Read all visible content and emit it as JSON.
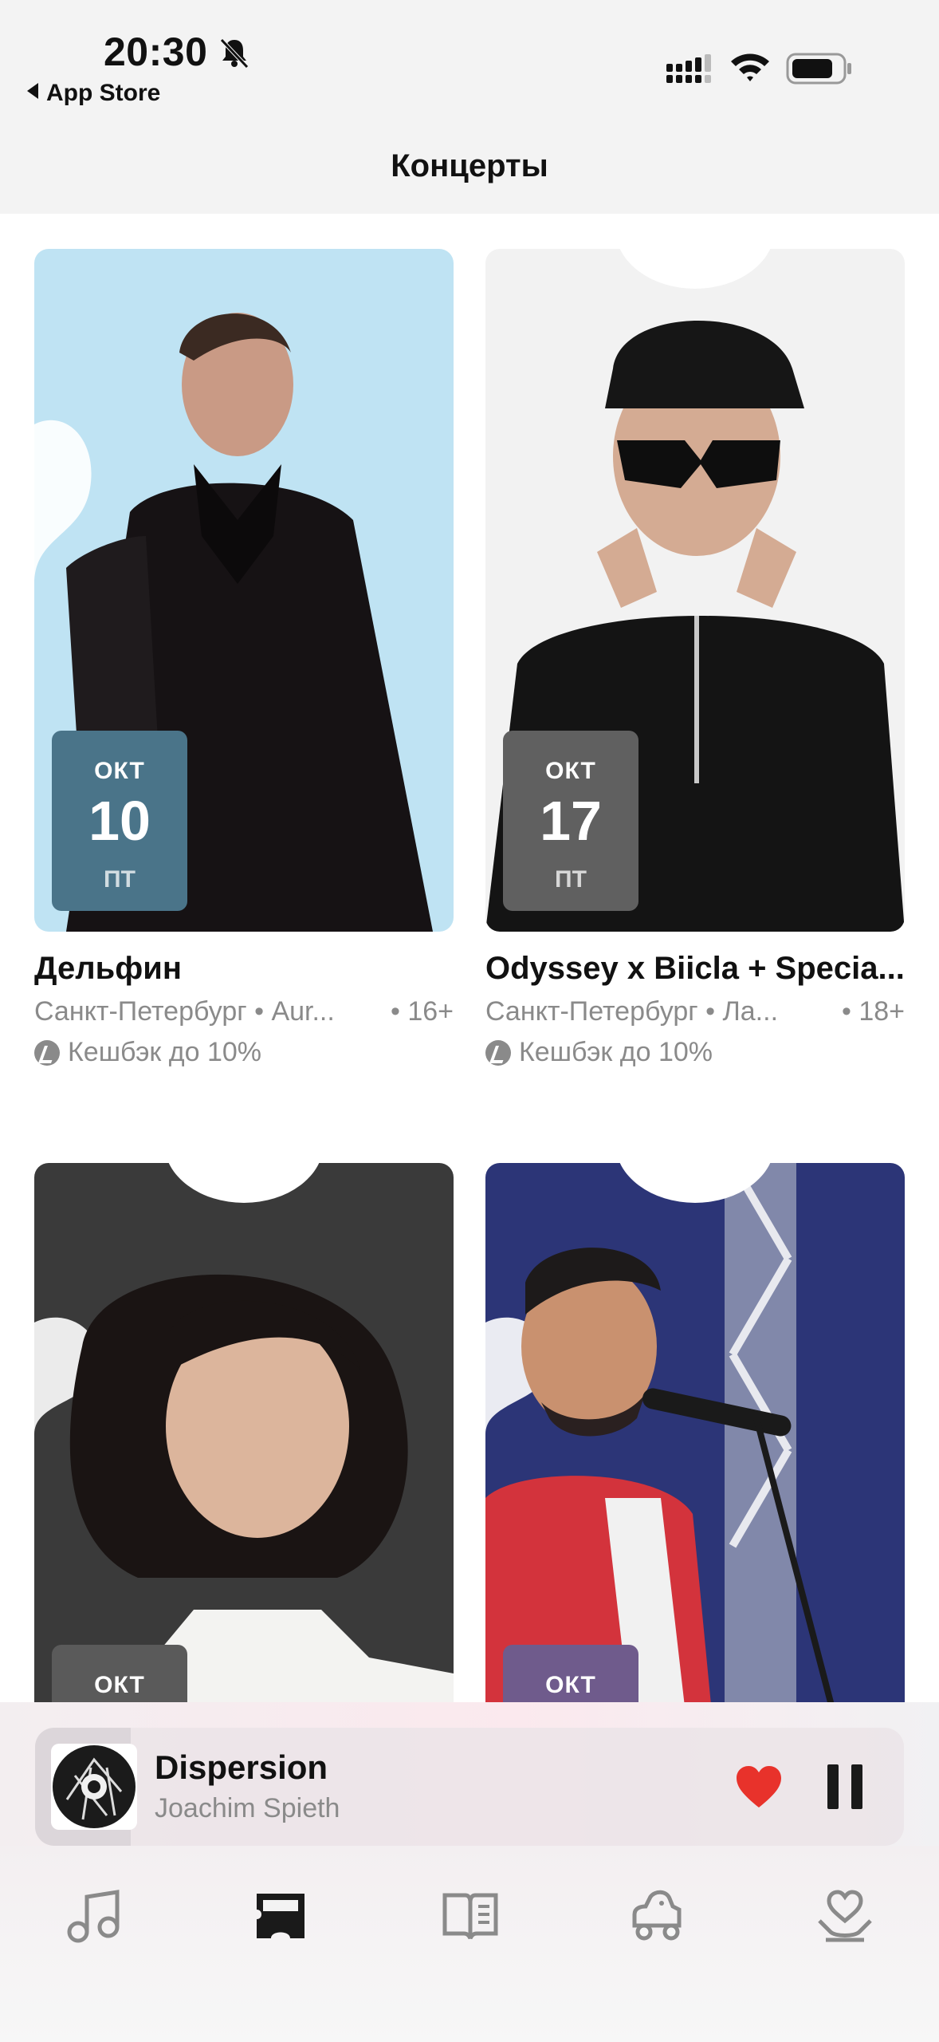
{
  "status_bar": {
    "time": "20:30",
    "back_label": "App Store"
  },
  "header": {
    "title": "Концерты"
  },
  "cards": [
    {
      "month": "ОКТ",
      "day": "10",
      "weekday": "ПТ",
      "name": "Дельфин",
      "place": "Санкт-Петербург • Aur...",
      "age": "• 16+",
      "cashback": "Кешбэк до 10%",
      "colors": {
        "bg": "#bfe3f3",
        "badge": "#4a7489"
      }
    },
    {
      "month": "ОКТ",
      "day": "17",
      "weekday": "ПТ",
      "name": "Odyssey x Biicla + Specia...",
      "place": "Санкт-Петербург • Ла...",
      "age": "• 18+",
      "cashback": "Кешбэк до 10%",
      "colors": {
        "bg": "#f2f2f2",
        "badge": "#606060"
      }
    },
    {
      "month": "ОКТ",
      "colors": {
        "bg": "#3a3a3a",
        "badge": "#5a5a5a"
      }
    },
    {
      "month": "ОКТ",
      "colors": {
        "bg": "#2c3577",
        "badge": "#6f5b8c"
      }
    }
  ],
  "player": {
    "title": "Dispersion",
    "artist": "Joachim Spieth",
    "progress": 0.11
  },
  "tabs": [
    {
      "icon": "music-note-icon"
    },
    {
      "icon": "ticket-icon"
    },
    {
      "icon": "book-icon"
    },
    {
      "icon": "kids-car-icon"
    },
    {
      "icon": "heart-hands-icon"
    }
  ],
  "accent": {
    "like": "#e8322b"
  }
}
